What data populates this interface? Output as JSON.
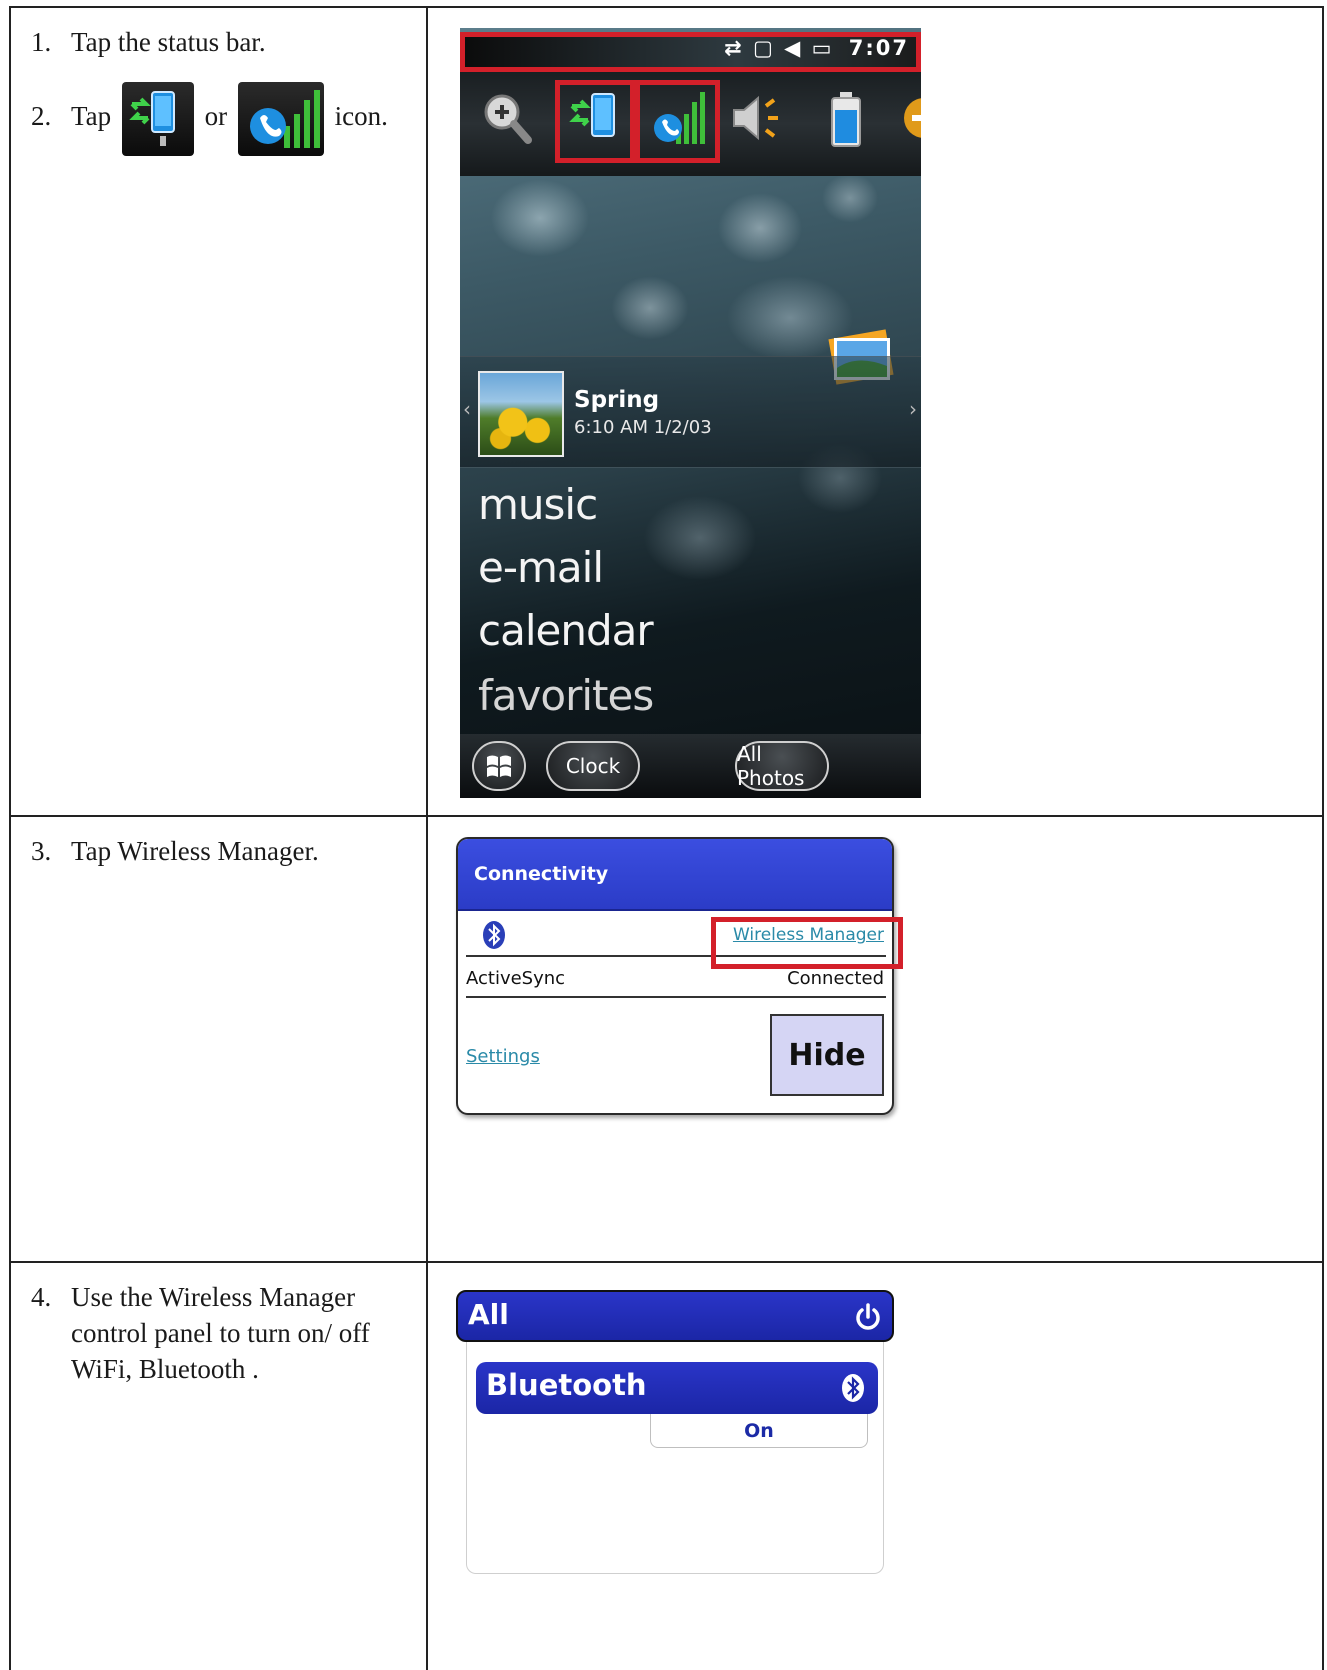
{
  "steps": {
    "step1": {
      "number": "1.",
      "text": "Tap the status bar."
    },
    "step2": {
      "number": "2.",
      "prefix": "Tap",
      "middle": "or",
      "suffix": "icon."
    },
    "step3": {
      "number": "3.",
      "text": "Tap Wireless Manager."
    },
    "step4": {
      "number": "4.",
      "line1": "Use the Wireless Manager",
      "line2": "control panel to turn on/ off",
      "line3": "WiFi, Bluetooth ."
    }
  },
  "phone": {
    "status_time": "7:07",
    "media": {
      "title": "Spring",
      "subtitle": "6:10 AM 1/2/03"
    },
    "menu": [
      "music",
      "e-mail",
      "calendar",
      "favorites"
    ],
    "softkeys": {
      "clock": "Clock",
      "photos": "All Photos"
    }
  },
  "connectivity": {
    "title": "Connectivity",
    "wireless_manager_link": "Wireless Manager",
    "activesync_label": "ActiveSync",
    "activesync_status": "Connected",
    "settings_link": "Settings",
    "hide_button": "Hide"
  },
  "wireless_manager": {
    "all_label": "All",
    "bluetooth_label": "Bluetooth",
    "bluetooth_state": "On"
  },
  "icons": {
    "connectivity": "connectivity-icon",
    "signal": "signal-icon",
    "zoom": "zoom-icon",
    "volume": "volume-icon",
    "battery": "battery-icon",
    "bluetooth": "bluetooth-icon",
    "power": "power-icon",
    "windows": "windows-start-icon"
  },
  "colors": {
    "highlight": "#d3202a",
    "dialog_header": "#2b3cc7",
    "link": "#2a8aa8",
    "hide_button": "#d5d5f4"
  }
}
